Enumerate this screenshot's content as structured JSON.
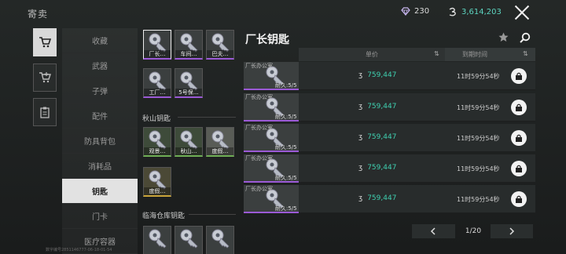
{
  "header": {
    "title": "寄卖",
    "gem_count": "230",
    "coin_count": "3,614,203",
    "close_icon": "close-icon"
  },
  "side_tabs": [
    {
      "icon": "shopping-cart-icon",
      "active": true
    },
    {
      "icon": "cart-add-icon",
      "active": false
    },
    {
      "icon": "clipboard-icon",
      "active": false
    }
  ],
  "categories": [
    {
      "label": "收藏"
    },
    {
      "label": "武器"
    },
    {
      "label": "子弹"
    },
    {
      "label": "配件"
    },
    {
      "label": "防具背包"
    },
    {
      "label": "消耗品"
    },
    {
      "label": "钥匙",
      "selected": true
    },
    {
      "label": "门卡"
    },
    {
      "label": "医疗容器"
    }
  ],
  "tiles_top": [
    {
      "label": "厂长…",
      "selected": true
    },
    {
      "label": "车间…"
    },
    {
      "label": "巴夫…"
    },
    {
      "label": "工厂…"
    },
    {
      "label": "5号保…"
    }
  ],
  "section_autumn": {
    "title": "秋山钥匙",
    "tiles": [
      {
        "label": "观景…",
        "rarity": "green"
      },
      {
        "label": "秋山…",
        "rarity": "green"
      },
      {
        "label": "度假…",
        "rarity": "green"
      },
      {
        "label": "度假…",
        "rarity": "yellow"
      }
    ]
  },
  "section_coast": {
    "title": "临海仓库钥匙"
  },
  "right": {
    "title": "厂长钥匙",
    "columns": {
      "price": "单价",
      "expire": "到期时间"
    },
    "rows": [
      {
        "name": "厂长办公室",
        "durability": "耐久:5/5",
        "price": "759,447",
        "time": "11时59分54秒"
      },
      {
        "name": "厂长办公室",
        "durability": "耐久:5/5",
        "price": "759,447",
        "time": "11时59分54秒"
      },
      {
        "name": "厂长办公室",
        "durability": "耐久:5/5",
        "price": "759,447",
        "time": "11时59分54秒"
      },
      {
        "name": "厂长办公室",
        "durability": "耐久:5/5",
        "price": "759,447",
        "time": "11时59分54秒"
      },
      {
        "name": "厂长办公室",
        "durability": "耐久:5/5",
        "price": "759,447",
        "time": "11时59分54秒"
      }
    ],
    "pagination": {
      "page": "1/20"
    }
  },
  "footnote": "数字编号2851146777-06-18-01-54",
  "colors": {
    "price": "#3fd0b0",
    "rarity_purple": "#9b5ad6",
    "rarity_green": "#6fae55",
    "rarity_yellow": "#c9a43a"
  }
}
